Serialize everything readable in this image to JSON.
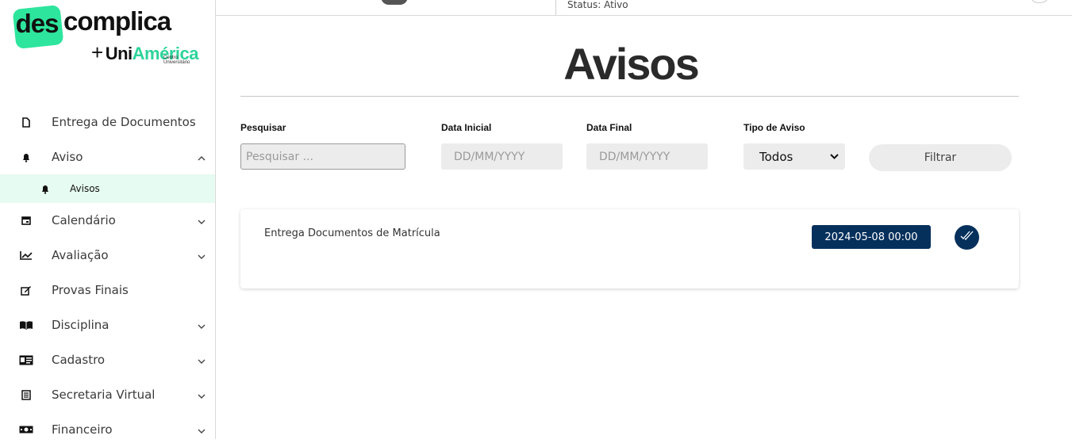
{
  "brand": {
    "des": "des",
    "complica": "complica",
    "plus": "+",
    "uni": "Uni",
    "america": "América",
    "centro": "Centro Universitário"
  },
  "topbar": {
    "status": "Status: Ativo"
  },
  "sidebar": {
    "items": [
      {
        "label": "Entrega de Documentos",
        "icon": "document-icon"
      },
      {
        "label": "Aviso",
        "icon": "bell-icon",
        "expanded": true
      },
      {
        "label": "Avisos",
        "icon": "bell-icon",
        "sub": true,
        "active": true
      },
      {
        "label": "Calendário",
        "icon": "calendar-icon"
      },
      {
        "label": "Avaliação",
        "icon": "chart-line-icon"
      },
      {
        "label": "Provas Finais",
        "icon": "edit-icon"
      },
      {
        "label": "Disciplina",
        "icon": "book-icon"
      },
      {
        "label": "Cadastro",
        "icon": "id-card-icon"
      },
      {
        "label": "Secretaria Virtual",
        "icon": "list-icon"
      },
      {
        "label": "Financeiro",
        "icon": "money-icon"
      }
    ]
  },
  "page": {
    "title": "Avisos"
  },
  "filters": {
    "search_label": "Pesquisar",
    "search_placeholder": "Pesquisar ...",
    "start_label": "Data Inicial",
    "start_placeholder": "DD/MM/YYYY",
    "end_label": "Data Final",
    "end_placeholder": "DD/MM/YYYY",
    "type_label": "Tipo de Aviso",
    "type_value": "Todos",
    "filter_button": "Filtrar"
  },
  "notices": [
    {
      "title": "Entrega Documentos de Matrícula",
      "date": "2024-05-08 00:00"
    }
  ]
}
